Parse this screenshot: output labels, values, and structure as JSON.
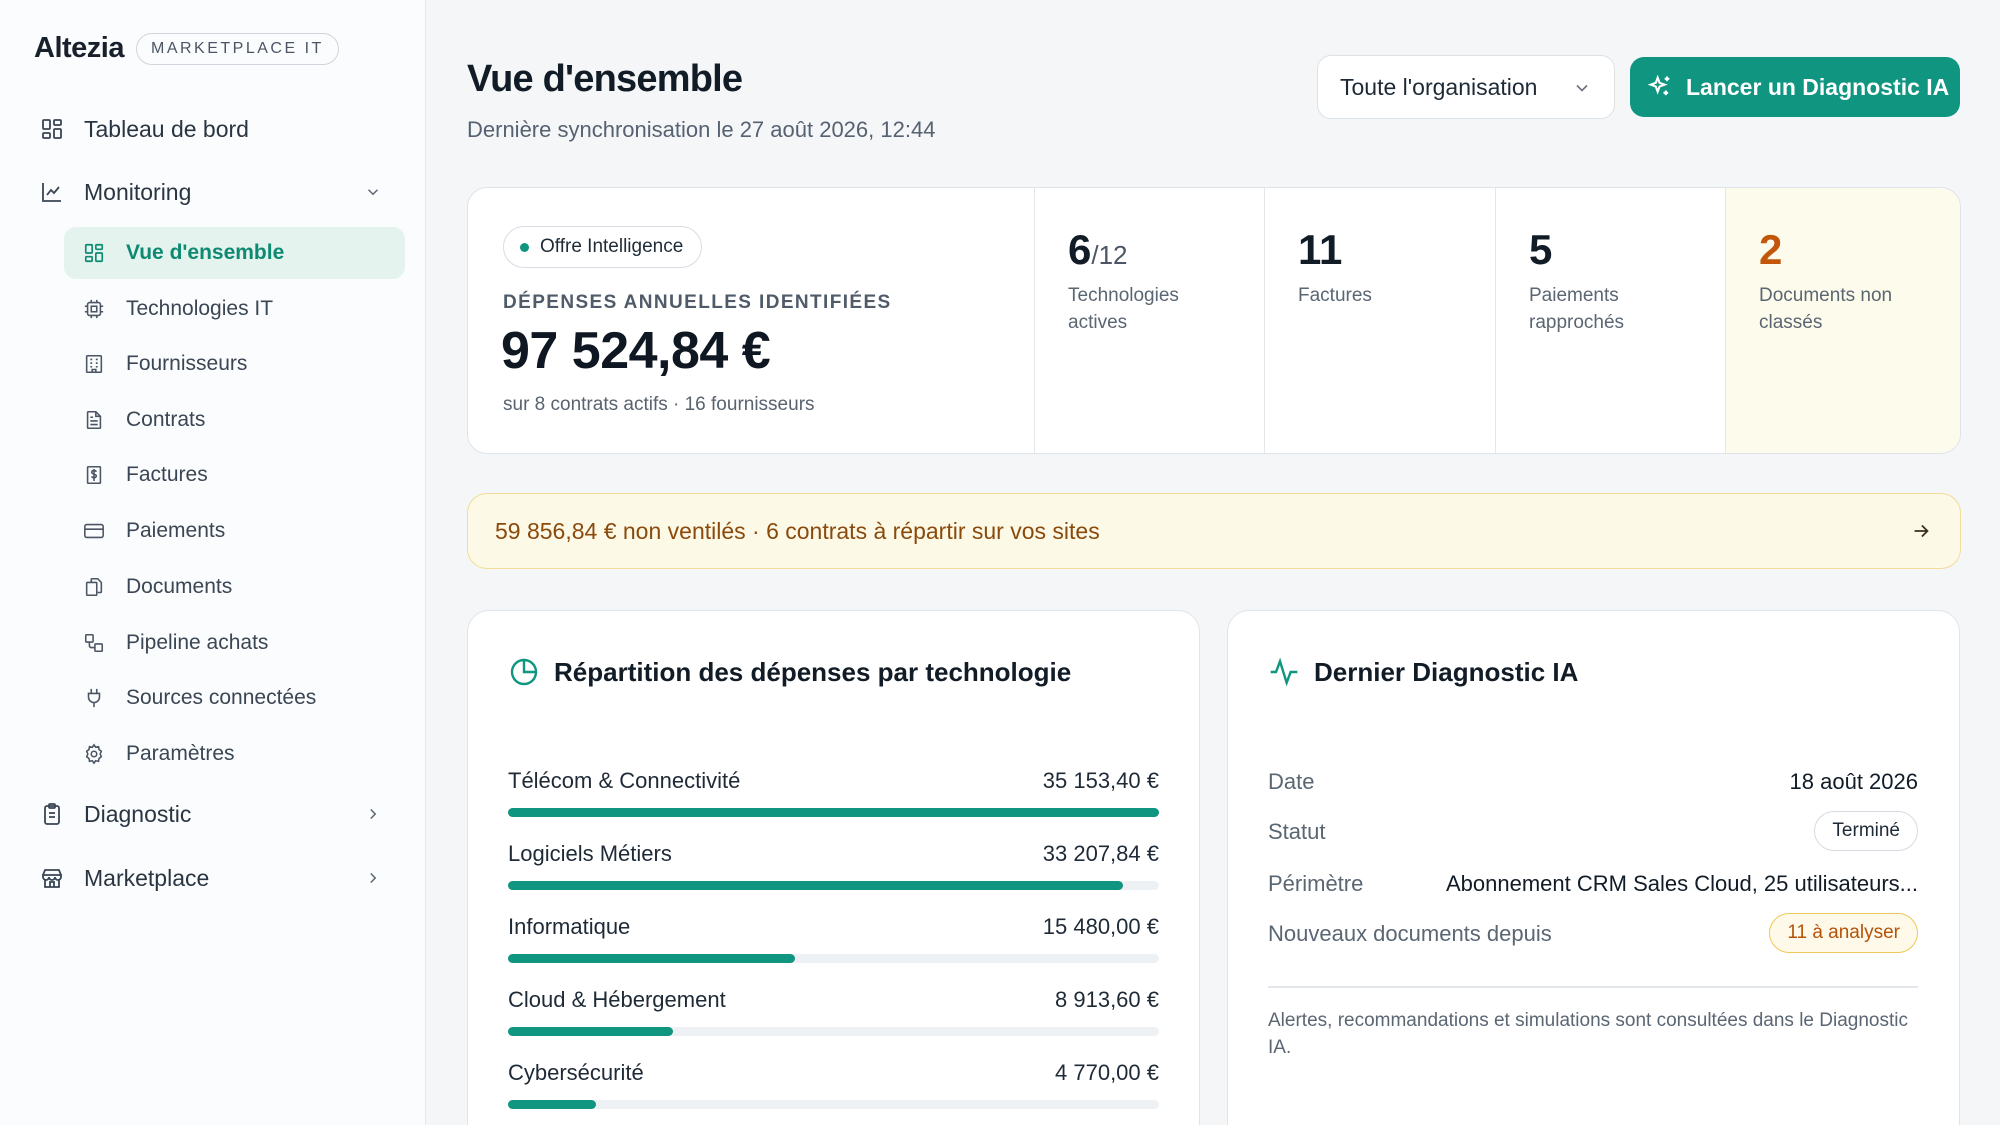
{
  "brand": {
    "name": "Altezia",
    "badge": "MARKETPLACE IT"
  },
  "sidebar": {
    "top_items": [
      {
        "label": "Tableau de bord",
        "icon": "grid-icon"
      },
      {
        "label": "Monitoring",
        "icon": "line-chart-icon",
        "expanded": true
      },
      {
        "label": "Diagnostic",
        "icon": "clipboard-icon",
        "expanded": false
      },
      {
        "label": "Marketplace",
        "icon": "store-icon",
        "expanded": false
      }
    ],
    "monitoring_items": [
      {
        "label": "Vue d'ensemble",
        "icon": "grid-icon",
        "active": true
      },
      {
        "label": "Technologies IT",
        "icon": "cpu-icon"
      },
      {
        "label": "Fournisseurs",
        "icon": "building-icon"
      },
      {
        "label": "Contrats",
        "icon": "file-text-icon"
      },
      {
        "label": "Factures",
        "icon": "invoice-icon"
      },
      {
        "label": "Paiements",
        "icon": "credit-card-icon"
      },
      {
        "label": "Documents",
        "icon": "files-icon"
      },
      {
        "label": "Pipeline achats",
        "icon": "pipeline-icon"
      },
      {
        "label": "Sources connectées",
        "icon": "plug-icon"
      },
      {
        "label": "Paramètres",
        "icon": "gear-icon"
      }
    ]
  },
  "header": {
    "title": "Vue d'ensemble",
    "sync": "Dernière synchronisation le 27 août 2026, 12:44",
    "org_select": "Toute l'organisation",
    "cta_label": "Lancer un Diagnostic IA"
  },
  "kpi": {
    "offer": "Offre Intelligence",
    "spend_label": "DÉPENSES ANNUELLES IDENTIFIÉES",
    "spend_value": "97 524,84 €",
    "spend_sub": "sur 8 contrats actifs · 16 fournisseurs",
    "tech_active": "6",
    "tech_total": "/12",
    "tech_label": "Technologies actives",
    "invoices": "11",
    "invoices_label": "Factures",
    "payments": "5",
    "payments_label": "Paiements rapprochés",
    "unclassified": "2",
    "unclassified_label": "Documents non classés"
  },
  "banner": {
    "text": "59 856,84 € non ventilés · 6 contrats à répartir sur vos sites"
  },
  "breakdown": {
    "title": "Répartition des dépenses par technologie",
    "rows": [
      {
        "label": "Télécom & Connectivité",
        "amount": "35 153,40 €",
        "value": 35153.4
      },
      {
        "label": "Logiciels Métiers",
        "amount": "33 207,84 €",
        "value": 33207.84
      },
      {
        "label": "Informatique",
        "amount": "15 480,00 €",
        "value": 15480.0
      },
      {
        "label": "Cloud & Hébergement",
        "amount": "8 913,60 €",
        "value": 8913.6
      },
      {
        "label": "Cybersécurité",
        "amount": "4 770,00 €",
        "value": 4770.0
      }
    ]
  },
  "diagnostic": {
    "title": "Dernier Diagnostic IA",
    "date_label": "Date",
    "date_value": "18 août 2026",
    "status_label": "Statut",
    "status_value": "Terminé",
    "scope_label": "Périmètre",
    "scope_value": "Abonnement CRM Sales Cloud, 25 utilisateurs...",
    "newdocs_label": "Nouveaux documents depuis",
    "newdocs_value": "11 à analyser",
    "note": "Alertes, recommandations et simulations sont consultées dans le Diagnostic IA."
  },
  "colors": {
    "accent": "#0f9580",
    "warning": "#c2570c",
    "banner_bg": "#fdf9e7"
  }
}
